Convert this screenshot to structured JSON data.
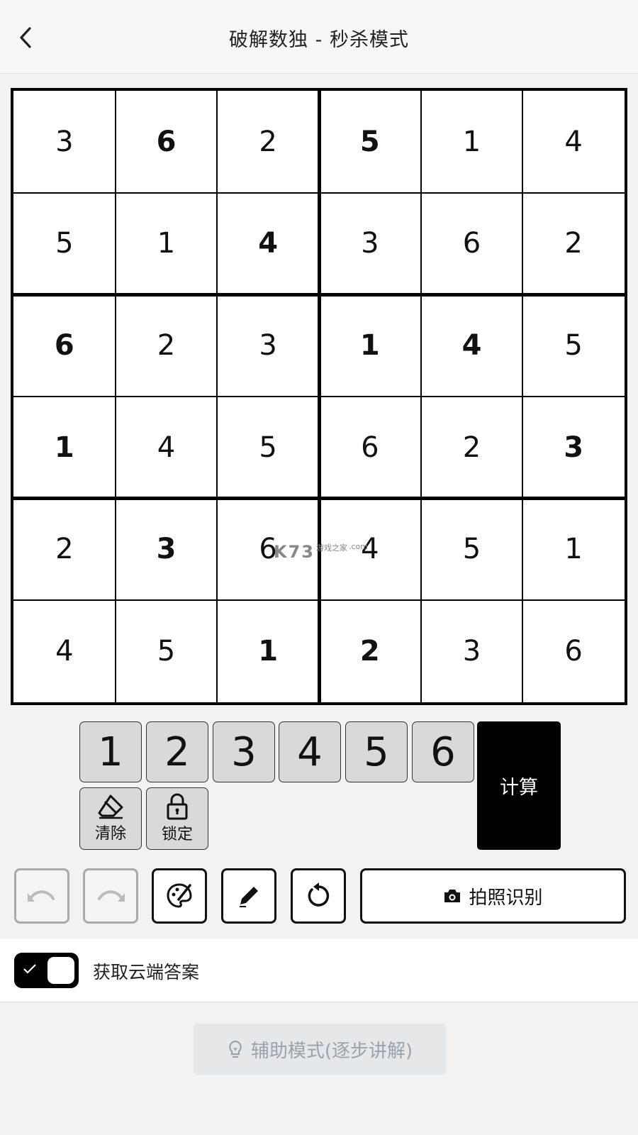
{
  "header": {
    "title": "破解数独 - 秒杀模式"
  },
  "board": {
    "values": [
      [
        3,
        6,
        2,
        5,
        1,
        4
      ],
      [
        5,
        1,
        4,
        3,
        6,
        2
      ],
      [
        6,
        2,
        3,
        1,
        4,
        5
      ],
      [
        1,
        4,
        5,
        6,
        2,
        3
      ],
      [
        2,
        3,
        6,
        4,
        5,
        1
      ],
      [
        4,
        5,
        1,
        2,
        3,
        6
      ]
    ],
    "given": [
      [
        false,
        true,
        false,
        true,
        false,
        false
      ],
      [
        false,
        false,
        true,
        false,
        false,
        false
      ],
      [
        true,
        false,
        false,
        true,
        true,
        false
      ],
      [
        true,
        false,
        false,
        false,
        false,
        true
      ],
      [
        false,
        true,
        false,
        false,
        false,
        false
      ],
      [
        false,
        false,
        true,
        true,
        false,
        false
      ]
    ]
  },
  "watermark": {
    "brand": "K73",
    "sub": "游戏之家",
    "domain": ".com"
  },
  "keypad": {
    "digits": [
      "1",
      "2",
      "3",
      "4",
      "5",
      "6"
    ],
    "clear_label": "清除",
    "lock_label": "锁定",
    "calc_label": "计算"
  },
  "toolbar": {
    "photo_label": "拍照识别"
  },
  "cloud": {
    "label": "获取云端答案",
    "enabled": true
  },
  "assist": {
    "label": "辅助模式(逐步讲解)"
  }
}
